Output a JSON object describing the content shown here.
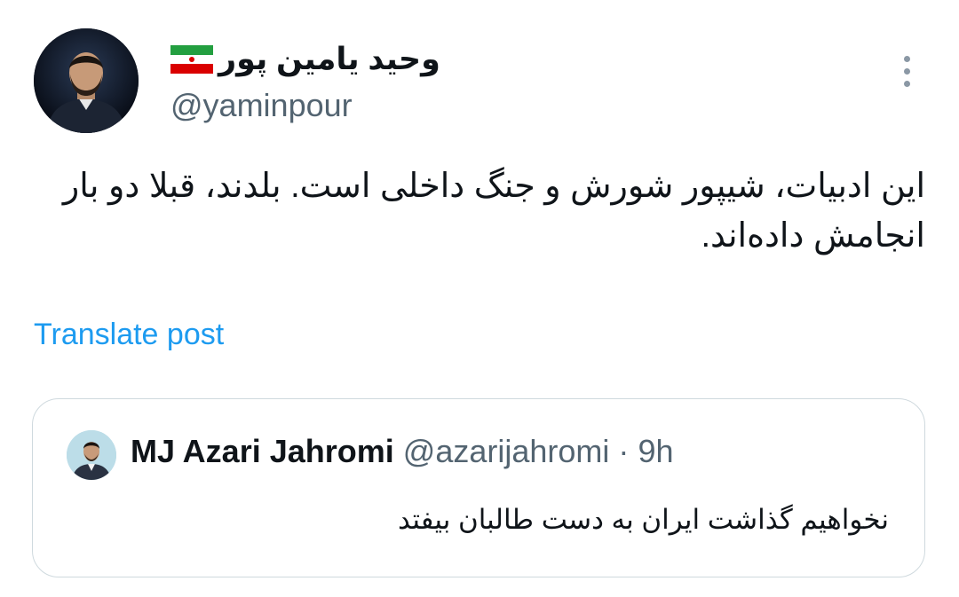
{
  "tweet": {
    "display_name": "وحید یامین پور",
    "handle": "@yaminpour",
    "flag_icon": "iran-flag",
    "text": "این ادبیات، شیپور شورش و جنگ داخلی است. بلدند، قبلا دو بار انجامش داده‌اند.",
    "translate_label": "Translate post",
    "more_icon": "more-vertical-icon"
  },
  "quote": {
    "display_name": "MJ Azari Jahromi",
    "handle": "@azarijahromi",
    "separator": "·",
    "time": "9h",
    "text": "نخواهیم گذاشت ایران به دست طالبان بیفتد"
  },
  "colors": {
    "link": "#1d9bf0",
    "secondary_text": "#536471",
    "border": "#cfd9de"
  }
}
